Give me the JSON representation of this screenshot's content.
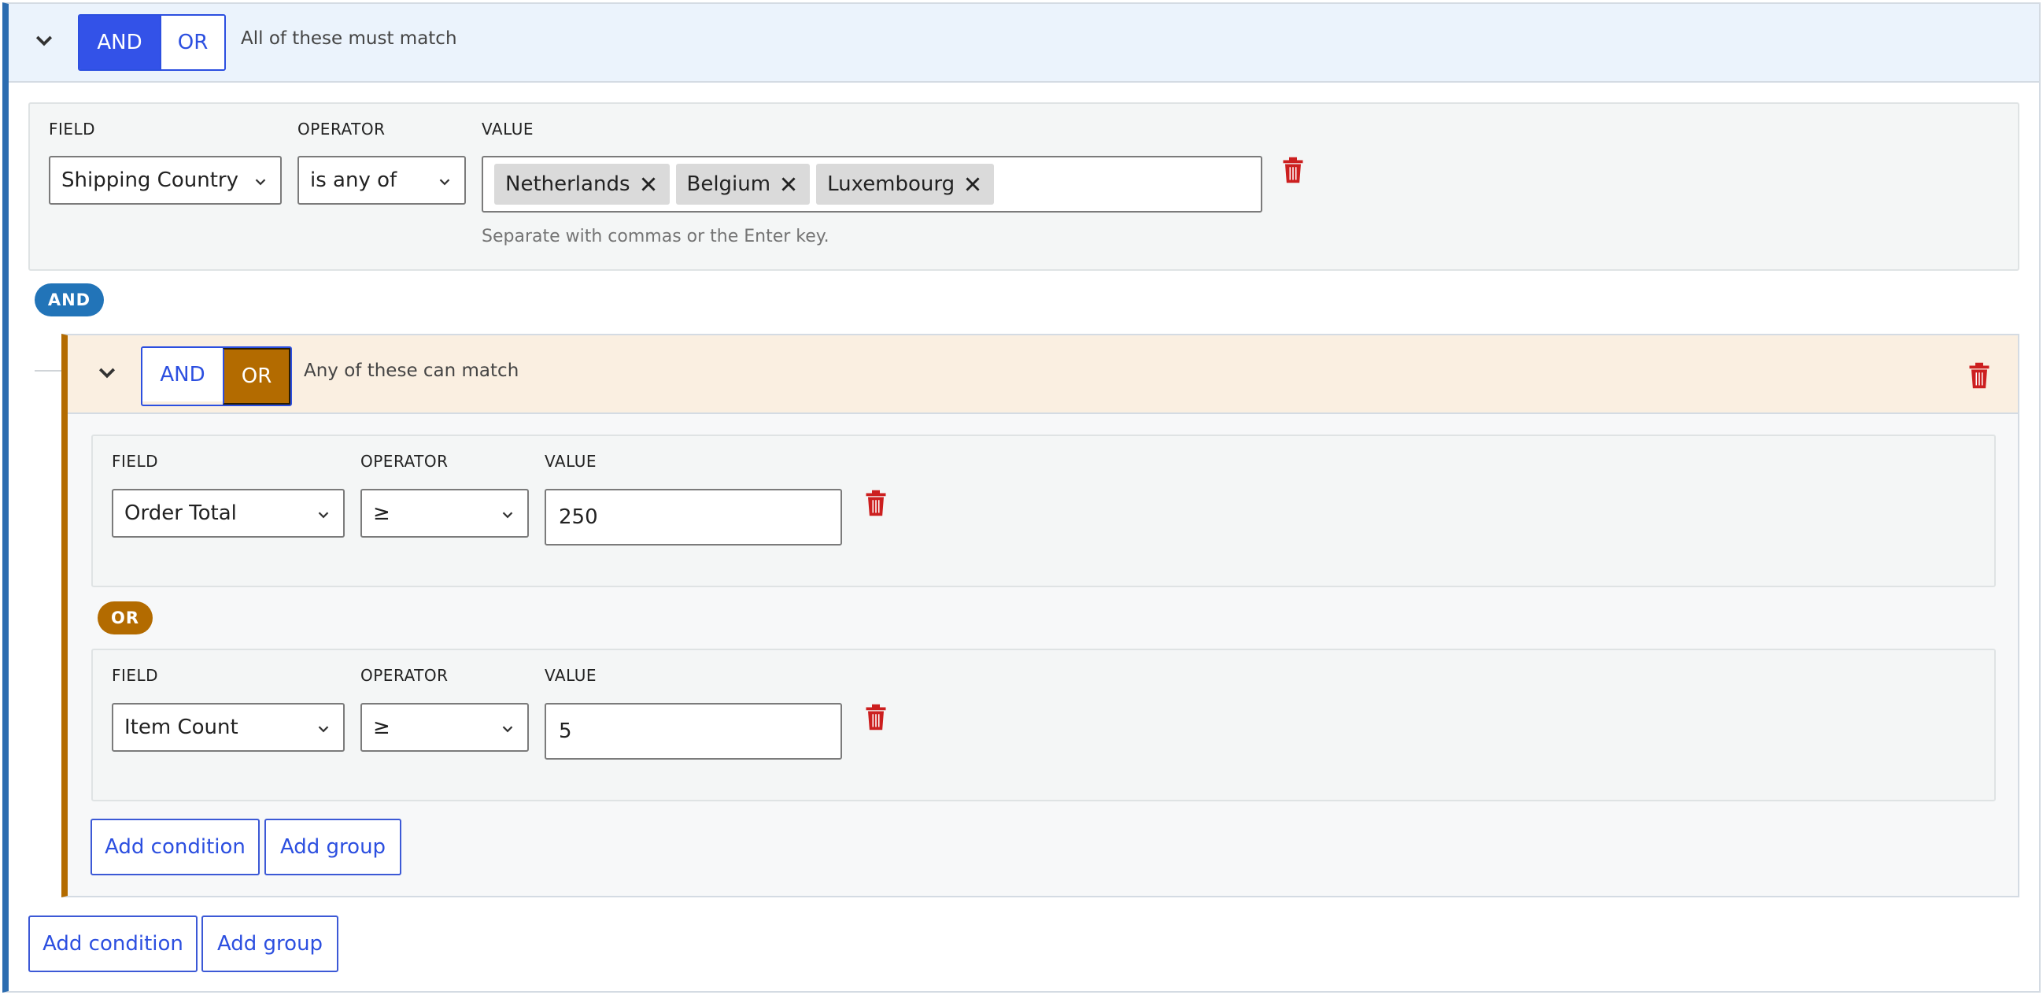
{
  "root_group": {
    "toggle": {
      "and_label": "AND",
      "or_label": "OR",
      "selected": "AND"
    },
    "description": "All of these must match",
    "condition": {
      "field_label": "FIELD",
      "field_value": "Shipping Country",
      "operator_label": "OPERATOR",
      "operator_value": "is any of",
      "value_label": "VALUE",
      "tags": [
        "Netherlands",
        "Belgium",
        "Luxembourg"
      ],
      "hint": "Separate with commas or the Enter key."
    },
    "connector": "AND",
    "add_condition": "Add condition",
    "add_group": "Add group"
  },
  "nested_group": {
    "toggle": {
      "and_label": "AND",
      "or_label": "OR",
      "selected": "OR"
    },
    "description": "Any of these can match",
    "conditions": [
      {
        "field_label": "FIELD",
        "field_value": "Order Total",
        "operator_label": "OPERATOR",
        "operator_value": "≥",
        "value_label": "VALUE",
        "value": "250"
      },
      {
        "field_label": "FIELD",
        "field_value": "Item Count",
        "operator_label": "OPERATOR",
        "operator_value": "≥",
        "value_label": "VALUE",
        "value": "5"
      }
    ],
    "connector": "OR",
    "add_condition": "Add condition",
    "add_group": "Add group"
  },
  "colors": {
    "and_accent": "#2b6cb0",
    "and_active": "#3352e8",
    "or_accent": "#b36b00",
    "delete": "#cc1f1f",
    "link_blue": "#2c4fe0"
  },
  "icons": {
    "collapse": "chevron-down-icon",
    "remove_tag": "close-icon",
    "delete": "trash-icon"
  }
}
